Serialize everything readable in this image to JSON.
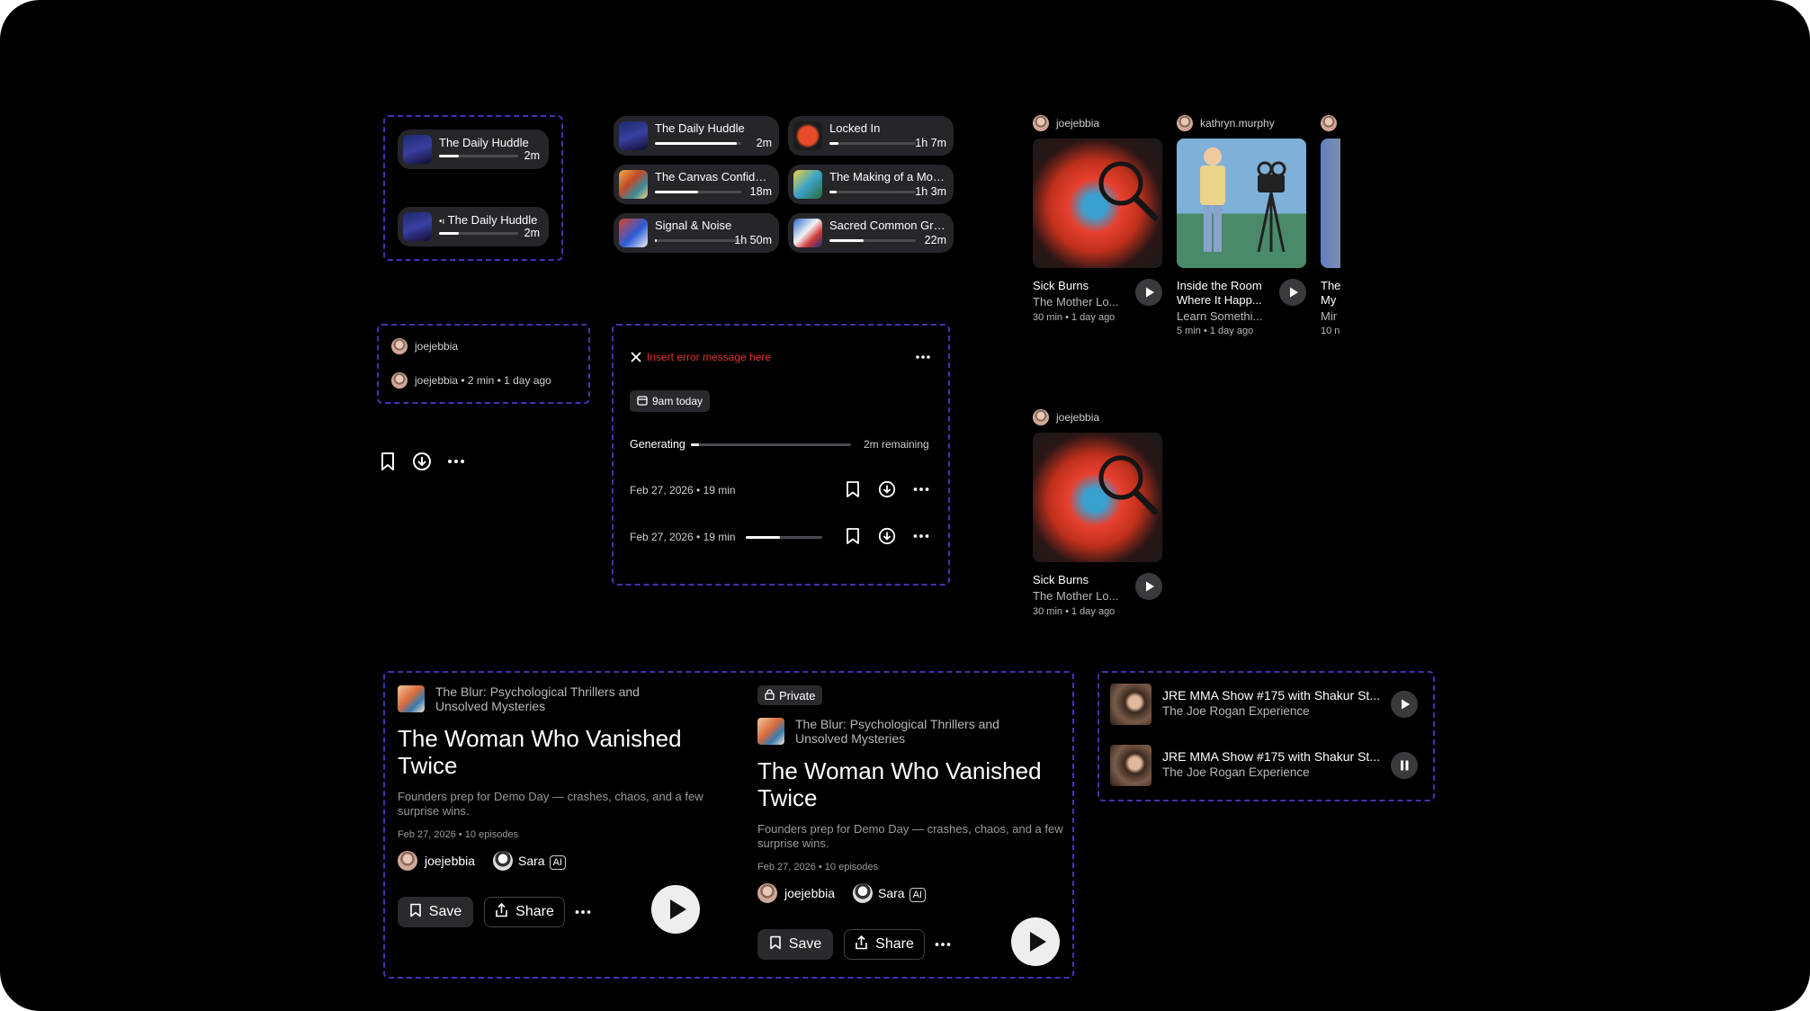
{
  "mini_players": [
    {
      "title": "The Daily Huddle",
      "duration": "2m",
      "progress": 0.25
    },
    {
      "title": "The Daily Huddle",
      "duration": "2m",
      "progress": 0.25,
      "prefix": "•ı"
    }
  ],
  "grid_players": [
    {
      "title": "The Daily Huddle",
      "duration": "2m",
      "progress": 0.95
    },
    {
      "title": "Locked In",
      "duration": "1h 7m",
      "progress": 0.1
    },
    {
      "title": "The Canvas Confidenti...",
      "duration": "18m",
      "progress": 0.5
    },
    {
      "title": "The Making of a Mons...",
      "duration": "1h 3m",
      "progress": 0.08
    },
    {
      "title": "Signal & Noise",
      "duration": "1h 50m",
      "progress": 0.02
    },
    {
      "title": "Sacred Common Grou...",
      "duration": "22m",
      "progress": 0.4
    }
  ],
  "author_rows": {
    "name": "joejebbia",
    "meta": "joejebbia • 2 min • 1 day ago"
  },
  "status_panel": {
    "error": "Insert error message here",
    "chip": "9am today",
    "generating_label": "Generating",
    "remaining": "2m remaining",
    "progress": 0.05,
    "rows": [
      {
        "meta": "Feb 27, 2026 • 19 min"
      },
      {
        "meta": "Feb 27, 2026 • 19 min",
        "progress": 0.45
      }
    ]
  },
  "tiles_row": [
    {
      "user": "joejebbia",
      "title": "Sick Burns",
      "show": "The Mother Lo...",
      "meta": "30 min • 1 day ago"
    },
    {
      "user": "kathryn.murphy",
      "title": "Inside the Room Where It Happ...",
      "show": "Learn Somethi...",
      "meta": "5 min • 1 day ago"
    },
    {
      "user": "",
      "title": "The My",
      "show": "Mir",
      "meta": "10 n"
    }
  ],
  "tile_single": {
    "user": "joejebbia",
    "title": "Sick Burns",
    "show": "The Mother Lo...",
    "meta": "30 min • 1 day ago"
  },
  "hero_cards": [
    {
      "private": "",
      "show": "The Blur: Psychological Thrillers and Unsolved Mysteries",
      "title": "The Woman Who Vanished Twice",
      "desc": "Founders prep for Demo Day — crashes, chaos, and a few surprise wins.",
      "meta": "Feb 27, 2026 • 10 episodes",
      "user1": "joejebbia",
      "user2": "Sara",
      "ai": "AI",
      "save": "Save",
      "share": "Share"
    },
    {
      "private": "Private",
      "show": "The Blur: Psychological Thrillers and Unsolved Mysteries",
      "title": "The Woman Who Vanished Twice",
      "desc": "Founders prep for Demo Day — crashes, chaos, and a few surprise wins.",
      "meta": "Feb 27, 2026 • 10 episodes",
      "user1": "joejebbia",
      "user2": "Sara",
      "ai": "AI",
      "save": "Save",
      "share": "Share"
    }
  ],
  "episode_rows": [
    {
      "title": "JRE MMA Show #175 with Shakur St...",
      "show": "The Joe Rogan Experience",
      "state": "play"
    },
    {
      "title": "JRE MMA Show #175 with Shakur St...",
      "show": "The Joe Rogan Experience",
      "state": "pause"
    }
  ],
  "colors": {
    "background": "#000000",
    "accent_dash": "#4a2fb0",
    "error": "#e0352b",
    "pill": "#26262a"
  }
}
